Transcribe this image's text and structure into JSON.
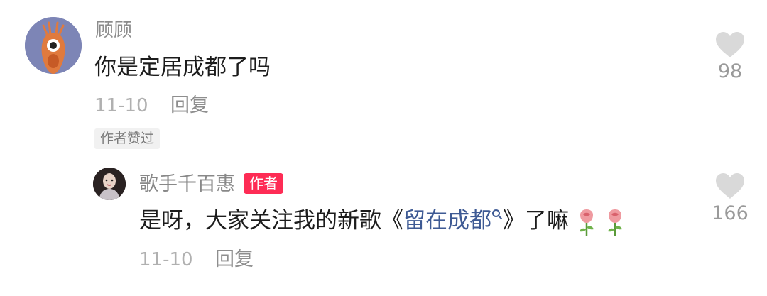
{
  "comment": {
    "username": "顾顾",
    "text": "你是定居成都了吗",
    "date": "11-10",
    "reply_label": "回复",
    "liked_badge": "作者赞过",
    "like_count": "98",
    "avatar_icon": "shrimp-cartoon-avatar"
  },
  "reply": {
    "username": "歌手千百惠",
    "author_tag": "作者",
    "text_before": "是呀，大家关注我的新歌《",
    "song_link": "留在成都",
    "text_after": "》了嘛",
    "date": "11-10",
    "reply_label": "回复",
    "like_count": "166",
    "avatar_icon": "singer-photo-avatar",
    "emoji": [
      "rose-emoji",
      "rose-emoji"
    ]
  },
  "colors": {
    "author_tag_bg": "#fe2c55",
    "link": "#3e5a94",
    "heart": "#d9d9d9"
  }
}
